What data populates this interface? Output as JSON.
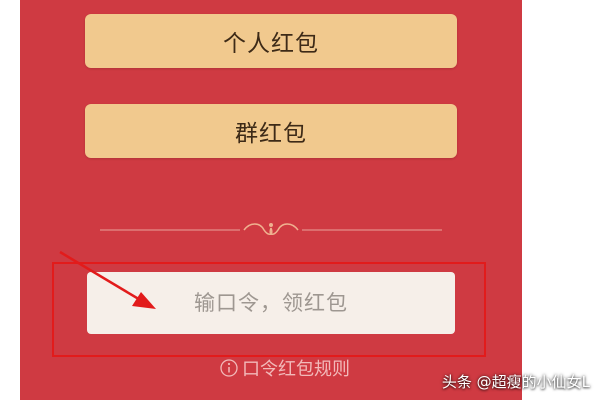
{
  "buttons": {
    "personal_label": "个人红包",
    "group_label": "群红包"
  },
  "code_input": {
    "placeholder": "输口令，领红包",
    "value": ""
  },
  "rules_link": {
    "label": "口令红包规则",
    "icon": "info-circle-icon"
  },
  "watermark": "头条 @超瘦的小仙女L",
  "colors": {
    "background": "#cf3a42",
    "button": "#f1c98e",
    "input": "#f6efe9",
    "annotation": "#e21b1b"
  }
}
